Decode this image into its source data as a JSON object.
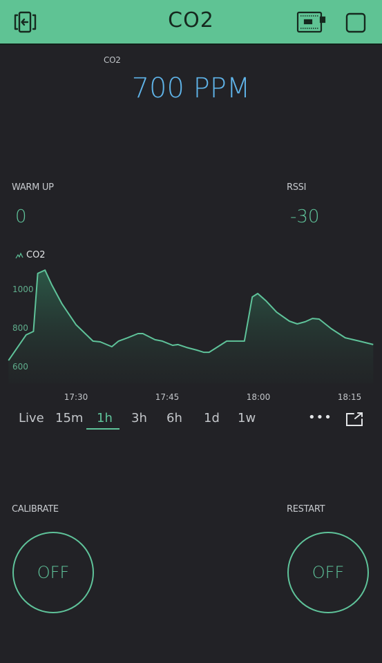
{
  "header": {
    "title": "CO2",
    "icons": {
      "back": "exit-to-left-icon",
      "device": "device-board-icon",
      "stop": "stop-square-icon"
    },
    "bg_color": "#5fc394"
  },
  "co2_display": {
    "label": "CO2",
    "value": "700 PPM",
    "color": "#5fb3e8"
  },
  "warm_up": {
    "label": "WARM UP",
    "value": "0"
  },
  "rssi": {
    "label": "RSSI",
    "value": "-30"
  },
  "accent_color": "#5fc39a",
  "chart_data": {
    "type": "area",
    "title": "",
    "legend": [
      "CO2"
    ],
    "legend_placement": "top-left",
    "xlabel": "",
    "ylabel": "",
    "x_ticks": [
      "17:30",
      "17:45",
      "18:00",
      "18:15"
    ],
    "y_ticks": [
      600,
      800,
      1000
    ],
    "ylim": [
      560,
      1130
    ],
    "grid": false,
    "series": [
      {
        "name": "CO2",
        "color": "#5fc39a",
        "x_minutes_from_1730": [
          -11.1,
          -8.2,
          -7.0,
          -6.3,
          -5.1,
          -4.0,
          -2.3,
          0,
          2.8,
          4.0,
          5.9,
          7.0,
          8.5,
          10.2,
          11.0,
          13.0,
          14.2,
          15.9,
          16.8,
          18.2,
          19.9,
          21.0,
          21.9,
          22.8,
          24.8,
          27.7,
          29.0,
          29.9,
          31.3,
          33.0,
          35.1,
          36.4,
          37.7,
          38.9,
          40.0,
          42.0,
          44.3,
          46.6,
          48.9
        ],
        "values": [
          629,
          761,
          779,
          1079,
          1096,
          1021,
          921,
          814,
          729,
          725,
          700,
          729,
          746,
          768,
          768,
          736,
          729,
          707,
          711,
          696,
          682,
          671,
          671,
          689,
          729,
          729,
          957,
          975,
          936,
          879,
          832,
          818,
          829,
          846,
          843,
          793,
          746,
          729,
          711
        ]
      }
    ]
  },
  "time_ranges": {
    "options": [
      "Live",
      "15m",
      "1h",
      "3h",
      "6h",
      "1d",
      "1w"
    ],
    "selected": "1h",
    "more_label": "•••",
    "more_icon": "more-horizontal-icon",
    "expand_icon": "expand-external-icon"
  },
  "calibrate": {
    "label": "CALIBRATE",
    "state": "OFF"
  },
  "restart": {
    "label": "RESTART",
    "state": "OFF"
  }
}
